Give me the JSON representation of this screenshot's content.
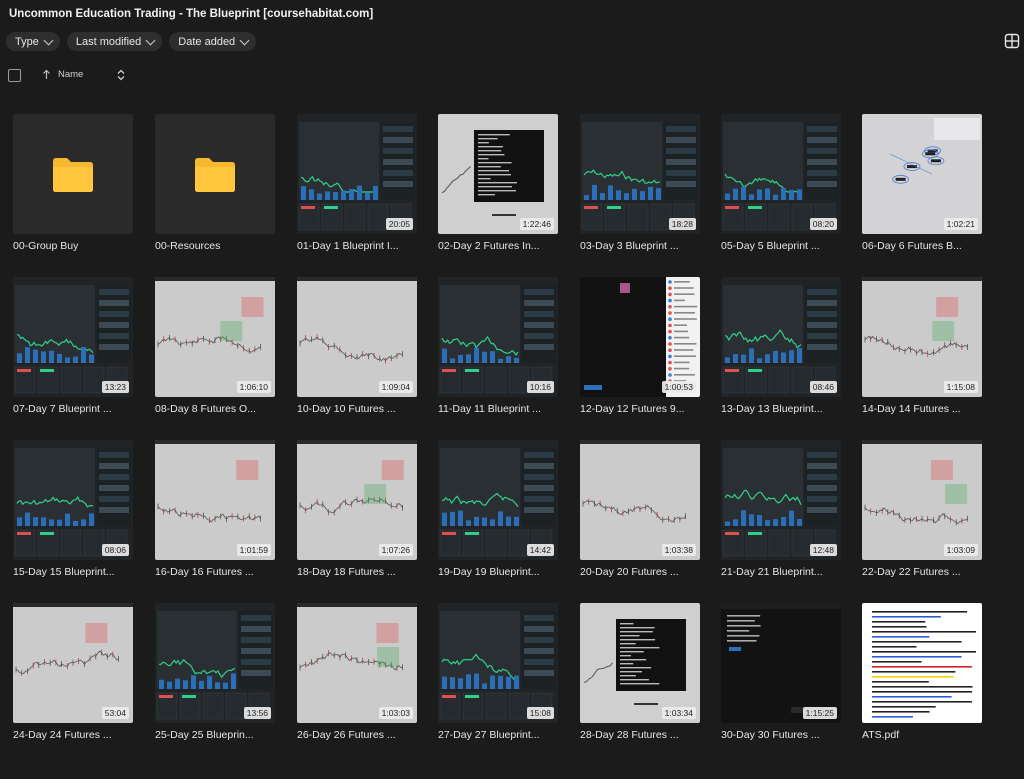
{
  "header": {
    "title": "Uncommon Education Trading - The Blueprint [coursehabitat.com]"
  },
  "filters": [
    {
      "label": "Type"
    },
    {
      "label": "Last modified"
    },
    {
      "label": "Date added"
    }
  ],
  "sort": {
    "column_label": "Name"
  },
  "colors": {
    "background": "#1b1b1b",
    "folder": "#f5b82e",
    "up_green": "#2fd08a",
    "down_red": "#e05050"
  },
  "items": [
    {
      "kind": "folder",
      "label": "00-Group Buy"
    },
    {
      "kind": "folder",
      "label": "00-Resources"
    },
    {
      "kind": "video",
      "label": "01-Day 1 Blueprint I...",
      "duration": "20:05",
      "thumb": "dark-chart"
    },
    {
      "kind": "video",
      "label": "02-Day 2 Futures In...",
      "duration": "1:22:46",
      "thumb": "light-terminal"
    },
    {
      "kind": "video",
      "label": "03-Day 3 Blueprint ...",
      "duration": "18:28",
      "thumb": "dark-chart"
    },
    {
      "kind": "video",
      "label": "05-Day 5 Blueprint ...",
      "duration": "08:20",
      "thumb": "dark-chart"
    },
    {
      "kind": "video",
      "label": "06-Day 6 Futures B...",
      "duration": "1:02:21",
      "thumb": "light-diagram"
    },
    {
      "kind": "video",
      "label": "07-Day 7 Blueprint ...",
      "duration": "13:23",
      "thumb": "dark-chart"
    },
    {
      "kind": "video",
      "label": "08-Day 8 Futures O...",
      "duration": "1:06:10",
      "thumb": "light-chart"
    },
    {
      "kind": "video",
      "label": "10-Day 10 Futures ...",
      "duration": "1:09:04",
      "thumb": "light-chart"
    },
    {
      "kind": "video",
      "label": "11-Day 11 Blueprint ...",
      "duration": "10:16",
      "thumb": "dark-chart"
    },
    {
      "kind": "video",
      "label": "12-Day 12 Futures 9...",
      "duration": "1:00:53",
      "thumb": "chat"
    },
    {
      "kind": "video",
      "label": "13-Day 13 Blueprint...",
      "duration": "08:46",
      "thumb": "dark-chart"
    },
    {
      "kind": "video",
      "label": "14-Day 14 Futures ...",
      "duration": "1:15:08",
      "thumb": "light-chart"
    },
    {
      "kind": "video",
      "label": "15-Day 15 Blueprint...",
      "duration": "08:06",
      "thumb": "dark-chart"
    },
    {
      "kind": "video",
      "label": "16-Day 16 Futures ...",
      "duration": "1:01:59",
      "thumb": "light-chart"
    },
    {
      "kind": "video",
      "label": "18-Day 18 Futures ...",
      "duration": "1:07:26",
      "thumb": "light-chart"
    },
    {
      "kind": "video",
      "label": "19-Day 19 Blueprint...",
      "duration": "14:42",
      "thumb": "dark-chart"
    },
    {
      "kind": "video",
      "label": "20-Day 20 Futures ...",
      "duration": "1:03:38",
      "thumb": "light-chart"
    },
    {
      "kind": "video",
      "label": "21-Day 21 Blueprint...",
      "duration": "12:48",
      "thumb": "dark-chart"
    },
    {
      "kind": "video",
      "label": "22-Day 22 Futures ...",
      "duration": "1:03:09",
      "thumb": "light-chart"
    },
    {
      "kind": "video",
      "label": "24-Day 24 Futures ...",
      "duration": "53:04",
      "thumb": "light-chart"
    },
    {
      "kind": "video",
      "label": "25-Day 25 Blueprin...",
      "duration": "13:56",
      "thumb": "dark-chart"
    },
    {
      "kind": "video",
      "label": "26-Day 26 Futures ...",
      "duration": "1:03:03",
      "thumb": "light-chart"
    },
    {
      "kind": "video",
      "label": "27-Day 27 Blueprint...",
      "duration": "15:08",
      "thumb": "dark-chart"
    },
    {
      "kind": "video",
      "label": "28-Day 28 Futures ...",
      "duration": "1:03:34",
      "thumb": "light-terminal"
    },
    {
      "kind": "video",
      "label": "30-Day 30 Futures ...",
      "duration": "1:15:25",
      "thumb": "dark-app"
    },
    {
      "kind": "document",
      "label": "ATS.pdf",
      "thumb": "pdf"
    }
  ]
}
